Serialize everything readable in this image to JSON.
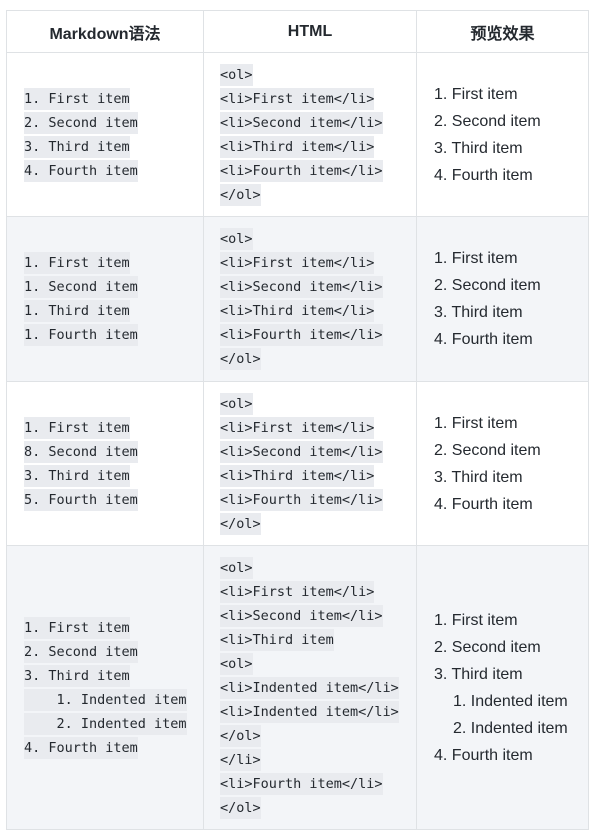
{
  "headers": [
    "Markdown语法",
    "HTML",
    "预览效果"
  ],
  "rows": [
    {
      "markdown": [
        "1. First item",
        "2. Second item",
        "3. Third item",
        "4. Fourth item"
      ],
      "html": [
        "<ol>",
        "<li>First item</li>",
        "<li>Second item</li>",
        "<li>Third item</li>",
        "<li>Fourth item</li>",
        "</ol>"
      ],
      "preview": [
        "1. First item",
        "2. Second item",
        "3. Third item",
        "4. Fourth item"
      ]
    },
    {
      "markdown": [
        "1. First item",
        "1. Second item",
        "1. Third item",
        "1. Fourth item"
      ],
      "html": [
        "<ol>",
        "<li>First item</li>",
        "<li>Second item</li>",
        "<li>Third item</li>",
        "<li>Fourth item</li>",
        "</ol>"
      ],
      "preview": [
        "1. First item",
        "2. Second item",
        "3. Third item",
        "4. Fourth item"
      ]
    },
    {
      "markdown": [
        "1. First item",
        "8. Second item",
        "3. Third item",
        "5. Fourth item"
      ],
      "html": [
        "<ol>",
        "<li>First item</li>",
        "<li>Second item</li>",
        "<li>Third item</li>",
        "<li>Fourth item</li>",
        "</ol>"
      ],
      "preview": [
        "1. First item",
        "2. Second item",
        "3. Third item",
        "4. Fourth item"
      ]
    },
    {
      "markdown": [
        "1. First item",
        "2. Second item",
        "3. Third item",
        "    1. Indented item",
        "    2. Indented item",
        "4. Fourth item"
      ],
      "html": [
        "<ol>",
        "<li>First item</li>",
        "<li>Second item</li>",
        "<li>Third item",
        "<ol>",
        "<li>Indented item</li>",
        "<li>Indented item</li>",
        "</ol>",
        "</li>",
        "<li>Fourth item</li>",
        "</ol>"
      ],
      "preview": [
        "1. First item",
        "2. Second item",
        "3. Third item",
        "1. Indented item",
        "2. Indented item",
        "4. Fourth item"
      ]
    }
  ],
  "colors": {
    "border": "#dfe2e5",
    "alt_row": "#f3f5f8",
    "code_bg": "#e9ebef",
    "text": "#24292f"
  }
}
